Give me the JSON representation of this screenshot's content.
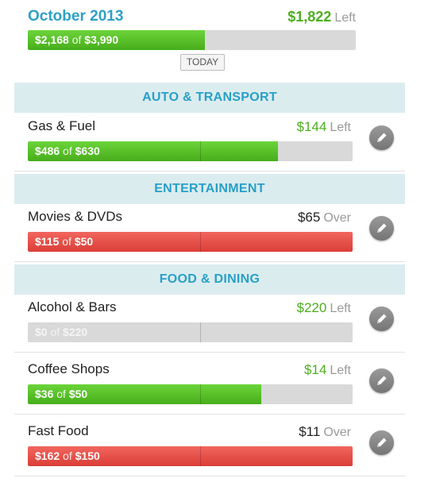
{
  "summary": {
    "month": "October 2013",
    "left_amount": "$1,822",
    "left_word": "Left",
    "spent": "$2,168",
    "of_word": "of",
    "budget": "$3,990",
    "progress": 0.54,
    "today_label": "TODAY"
  },
  "colors": {
    "accent_blue": "#2ea0c6",
    "section_bg": "#dbecef",
    "green": "#4caf1d",
    "red": "#da3e37",
    "track": "#d9d9d9"
  },
  "sections": [
    {
      "title": "AUTO & TRANSPORT",
      "items": [
        {
          "name": "Gas & Fuel",
          "status_amount": "$144",
          "status_word": "Left",
          "spent": "$486",
          "budget": "$630",
          "progress": 0.77,
          "over": false
        }
      ]
    },
    {
      "title": "ENTERTAINMENT",
      "items": [
        {
          "name": "Movies & DVDs",
          "status_amount": "$65",
          "status_word": "Over",
          "spent": "$115",
          "budget": "$50",
          "progress": 1.0,
          "over": true
        }
      ]
    },
    {
      "title": "FOOD & DINING",
      "items": [
        {
          "name": "Alcohol & Bars",
          "status_amount": "$220",
          "status_word": "Left",
          "spent": "$0",
          "budget": "$220",
          "progress": 0.0,
          "over": false
        },
        {
          "name": "Coffee Shops",
          "status_amount": "$14",
          "status_word": "Left",
          "spent": "$36",
          "budget": "$50",
          "progress": 0.72,
          "over": false
        },
        {
          "name": "Fast Food",
          "status_amount": "$11",
          "status_word": "Over",
          "spent": "$162",
          "budget": "$150",
          "progress": 1.0,
          "over": true
        }
      ]
    }
  ],
  "icons": {
    "edit": "pencil-icon"
  }
}
